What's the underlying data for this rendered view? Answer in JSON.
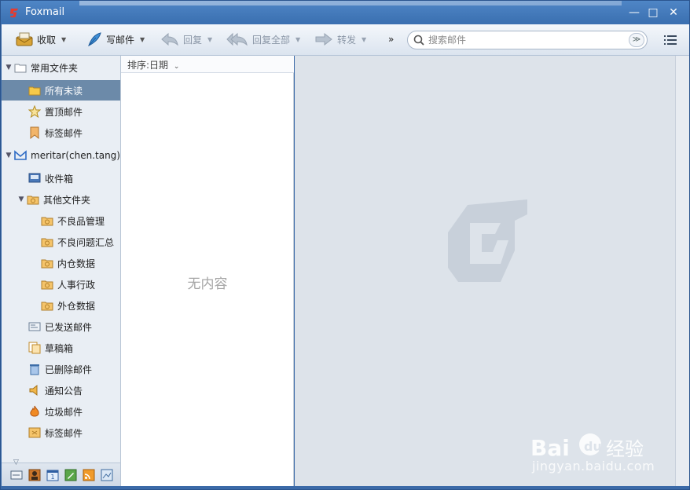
{
  "app": {
    "title": "Foxmail"
  },
  "window_controls": {
    "minimize": "—",
    "maximize": "□",
    "close": "✕"
  },
  "toolbar": {
    "receive": "收取",
    "compose": "写邮件",
    "reply": "回复",
    "reply_all": "回复全部",
    "forward": "转发",
    "more": "»",
    "search_placeholder": "搜索邮件",
    "search_dropdown": "≫"
  },
  "sidebar": {
    "common_folders": "常用文件夹",
    "all_unread": "所有未读",
    "pinned_mail": "置顶邮件",
    "tagged_mail": "标签邮件",
    "account": "meritar(chen.tang)",
    "inbox": "收件箱",
    "other_folders": "其他文件夹",
    "sub_folders": [
      "不良品管理",
      "不良问题汇总",
      "内仓数据",
      "人事行政",
      "外仓数据"
    ],
    "sent": "已发送邮件",
    "drafts": "草稿箱",
    "deleted": "已删除邮件",
    "notices": "通知公告",
    "spam": "垃圾邮件",
    "tagged": "标签邮件"
  },
  "list": {
    "sort_label": "排序:日期",
    "empty_text": "无内容"
  },
  "watermark": {
    "brand": "Bai du 经验",
    "url": "jingyan.baidu.com"
  }
}
